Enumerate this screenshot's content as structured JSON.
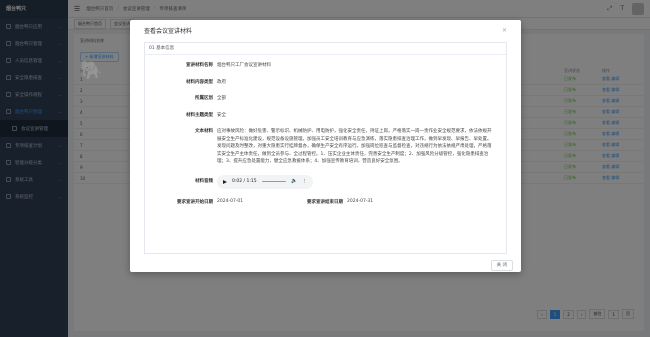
{
  "app": {
    "logo": "烟台鸭只"
  },
  "sidebar": {
    "items": [
      {
        "label": "烟台鸭只应用"
      },
      {
        "label": "烟台鸭只管理"
      },
      {
        "label": "人员信息管理"
      },
      {
        "label": "安全隐患排查"
      },
      {
        "label": "安全操作规程"
      },
      {
        "label": "烟台鸭只管理",
        "active": true
      },
      {
        "label": "会议宣讲管理",
        "sub": true
      },
      {
        "label": "专项排查计划"
      },
      {
        "label": "智能分级分类"
      },
      {
        "label": "系统工具"
      },
      {
        "label": "系统监控"
      }
    ]
  },
  "topbar": {
    "breadcrumb": [
      "烟台鸭只首页",
      "会议宣讲管理",
      "专项排查清单"
    ]
  },
  "tags": [
    "烟台鸭只首页",
    "会议宣讲"
  ],
  "background": {
    "filter_label": "宣讲材料名称",
    "add_button": "+ 新增宣讲材料",
    "columns": [
      "序号",
      "宣讲状态",
      "操作"
    ],
    "rows": [
      {
        "num": "1",
        "status": "已发布",
        "op": "查看 编辑"
      },
      {
        "num": "2",
        "status": "已发布",
        "op": "查看 编辑"
      },
      {
        "num": "3",
        "status": "已发布",
        "op": "查看 编辑"
      },
      {
        "num": "4",
        "status": "已发布",
        "op": "查看 编辑"
      },
      {
        "num": "5",
        "status": "已发布",
        "op": "查看 编辑"
      },
      {
        "num": "6",
        "status": "已发布",
        "op": "查看 编辑"
      },
      {
        "num": "7",
        "status": "已发布",
        "op": "查看 编辑"
      },
      {
        "num": "8",
        "status": "已发布",
        "op": "查看 编辑"
      },
      {
        "num": "9",
        "status": "已发布",
        "op": "查看 编辑"
      },
      {
        "num": "10",
        "status": "已发布",
        "op": "查看 编辑"
      }
    ],
    "pager": [
      "‹",
      "1",
      "2",
      "›",
      "前往",
      "1",
      "页"
    ]
  },
  "modal": {
    "title": "查看会议宣讲材料",
    "section": "01 基本信息",
    "fields": {
      "name_label": "宣讲材料名称",
      "name_value": "烟台鸭只工厂会议宣讲材料",
      "type_label": "材料内容类型",
      "type_value": "政府",
      "dept_label": "所属区划",
      "dept_value": "全部",
      "topic_label": "材料主题类型",
      "topic_value": "安全",
      "text_label": "文本材料",
      "text_value": "应对事故风险：做好危害、警示标识、机械防护、用电防护，强化安全责任，持证上岗，严格落实一岗一责作业安全规范要求，依法依规开展安全生产标准化建设，规范设备设施管理，加强员工安全培训教育与应急演练，落实隐患排查治理工作，做到早发现、早报告、早处置。发现问题及时整改，对重大隐患实行挂牌督办，确保生产安全有序运行。加强岗位巡查与监督检查，对违规行为依法依规严肃处理，严格落实安全生产主体责任，做到全员参与、全过程管控。1、压实企业主体责任，完善安全生产制度；2、加强风险分级管控，强化隐患排查治理；3、提升应急处置能力，健全应急救援体系；4、加强宣传教育培训，营造良好安全氛围。",
      "audio_label": "材料音频",
      "audio_time": "0:02 / 1:15",
      "start_label": "要求宣讲开始日期",
      "start_value": "2024-07-01",
      "end_label": "要求宣讲结束日期",
      "end_value": "2024-07-31"
    },
    "close_button": "关 闭"
  },
  "watermark": "程象"
}
